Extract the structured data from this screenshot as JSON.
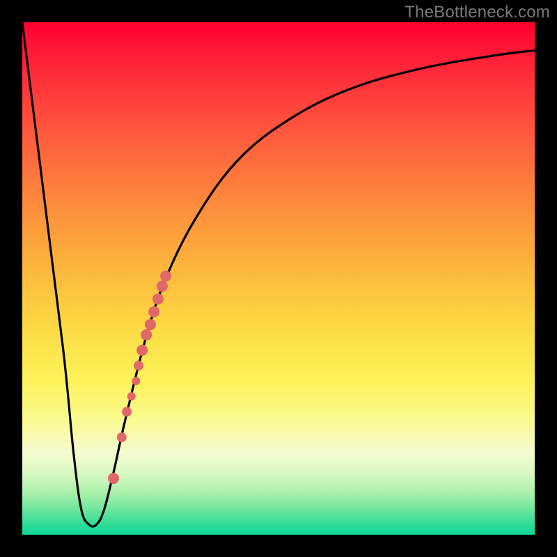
{
  "watermark": "TheBottleneck.com",
  "chart_data": {
    "type": "line",
    "title": "",
    "xlabel": "",
    "ylabel": "",
    "xlim": [
      0,
      100
    ],
    "ylim": [
      0,
      100
    ],
    "grid": false,
    "legend": false,
    "series": [
      {
        "name": "curve",
        "x": [
          0,
          4,
          8,
          10,
          11.5,
          13,
          14.5,
          16,
          18,
          20,
          24,
          28,
          34,
          42,
          52,
          64,
          78,
          92,
          100
        ],
        "y": [
          100,
          68,
          36,
          16,
          5,
          2,
          2,
          5,
          13,
          22,
          38,
          50,
          62,
          73,
          81,
          87,
          91,
          93.5,
          94.5
        ]
      }
    ],
    "scatter": {
      "name": "highlight-dots",
      "color": "#e06868",
      "points": [
        {
          "x": 17.8,
          "y": 11,
          "r": 8
        },
        {
          "x": 19.4,
          "y": 19,
          "r": 7
        },
        {
          "x": 20.4,
          "y": 24,
          "r": 7
        },
        {
          "x": 21.3,
          "y": 27,
          "r": 6
        },
        {
          "x": 22.2,
          "y": 30,
          "r": 6
        },
        {
          "x": 22.7,
          "y": 33,
          "r": 7
        },
        {
          "x": 23.4,
          "y": 36,
          "r": 8
        },
        {
          "x": 24.2,
          "y": 39,
          "r": 8
        },
        {
          "x": 25.0,
          "y": 41,
          "r": 8
        },
        {
          "x": 25.7,
          "y": 43.5,
          "r": 8
        },
        {
          "x": 26.5,
          "y": 46,
          "r": 8
        },
        {
          "x": 27.3,
          "y": 48.5,
          "r": 8
        },
        {
          "x": 28.0,
          "y": 50.5,
          "r": 8
        }
      ]
    }
  }
}
